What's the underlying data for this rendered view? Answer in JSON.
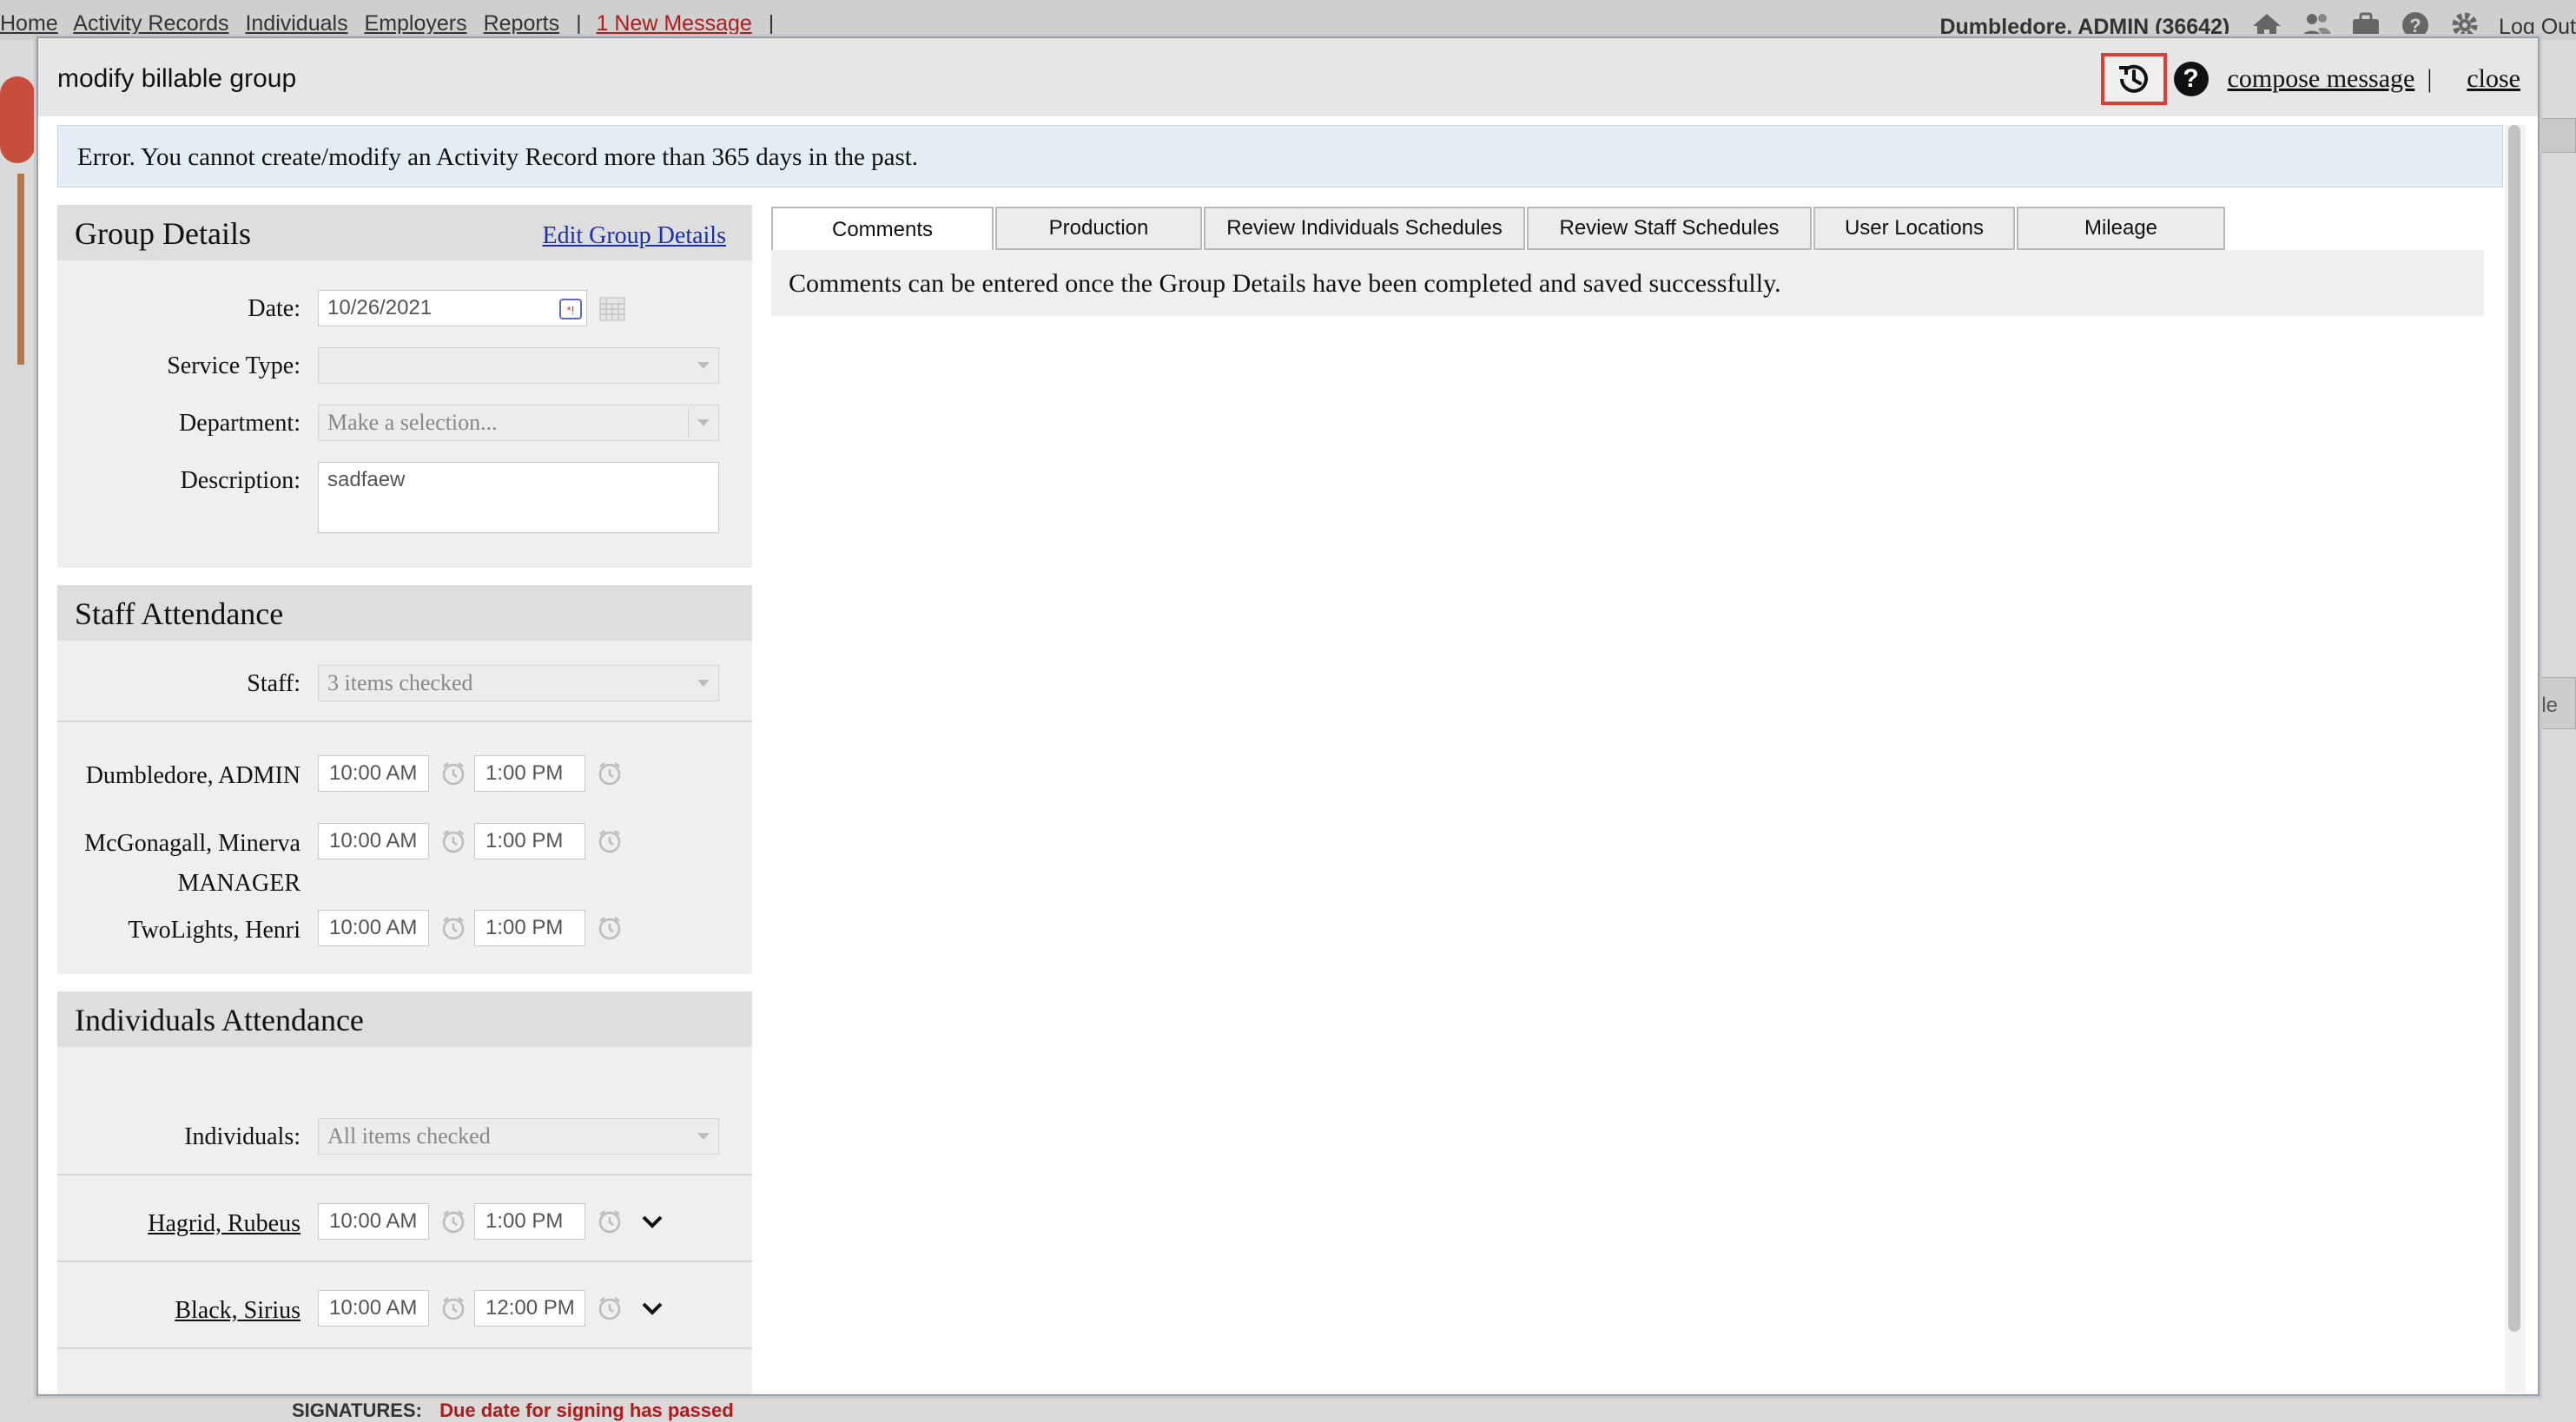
{
  "background": {
    "nav": {
      "links": [
        "Home",
        "Activity Records",
        "Individuals",
        "Employers",
        "Reports"
      ],
      "new_message": "1 New Message",
      "user": "Dumbledore, ADMIN  (36642)",
      "logout": "Log Out"
    },
    "bottom": {
      "signatures": "SIGNATURES:",
      "due": "Due date for signing has passed"
    },
    "right_tab": "ble"
  },
  "modal": {
    "title": "modify billable group",
    "compose_message": "compose message",
    "separator": "|",
    "close": "close",
    "help_glyph": "?"
  },
  "error": "Error. You cannot create/modify an Activity Record more than 365 days in the past.",
  "group_details": {
    "heading": "Group Details",
    "edit_link": "Edit Group Details",
    "date_label": "Date:",
    "date_value": "10/26/2021",
    "service_type_label": "Service Type:",
    "service_type_value": "",
    "department_label": "Department:",
    "department_placeholder": "Make a selection...",
    "description_label": "Description:",
    "description_value": "sadfaew"
  },
  "staff_attendance": {
    "heading": "Staff Attendance",
    "staff_label": "Staff:",
    "staff_value": "3 items checked",
    "members": [
      {
        "name": "Dumbledore, ADMIN",
        "start": "10:00 AM",
        "end": "1:00 PM"
      },
      {
        "name": "McGonagall, Minerva",
        "name2": "MANAGER",
        "start": "10:00 AM",
        "end": "1:00 PM"
      },
      {
        "name": "TwoLights, Henri",
        "start": "10:00 AM",
        "end": "1:00 PM"
      }
    ]
  },
  "individuals_attendance": {
    "heading": "Individuals Attendance",
    "individuals_label": "Individuals:",
    "individuals_value": "All items checked",
    "members": [
      {
        "name": "Hagrid, Rubeus",
        "start": "10:00 AM",
        "end": "1:00 PM"
      },
      {
        "name": "Black, Sirius",
        "start": "10:00 AM",
        "end": "12:00 PM"
      }
    ]
  },
  "tabs": [
    {
      "label": "Comments",
      "active": true
    },
    {
      "label": "Production"
    },
    {
      "label": "Review Individuals Schedules"
    },
    {
      "label": "Review Staff Schedules"
    },
    {
      "label": "User Locations"
    },
    {
      "label": "Mileage"
    }
  ],
  "tab_content": "Comments can be entered once the Group Details have been completed and saved successfully.",
  "colors": {
    "highlight_border": "#e03c31",
    "link_blue": "#1a2fb0",
    "error_bg": "#e4edf3",
    "alert_red": "#b01b1b"
  }
}
